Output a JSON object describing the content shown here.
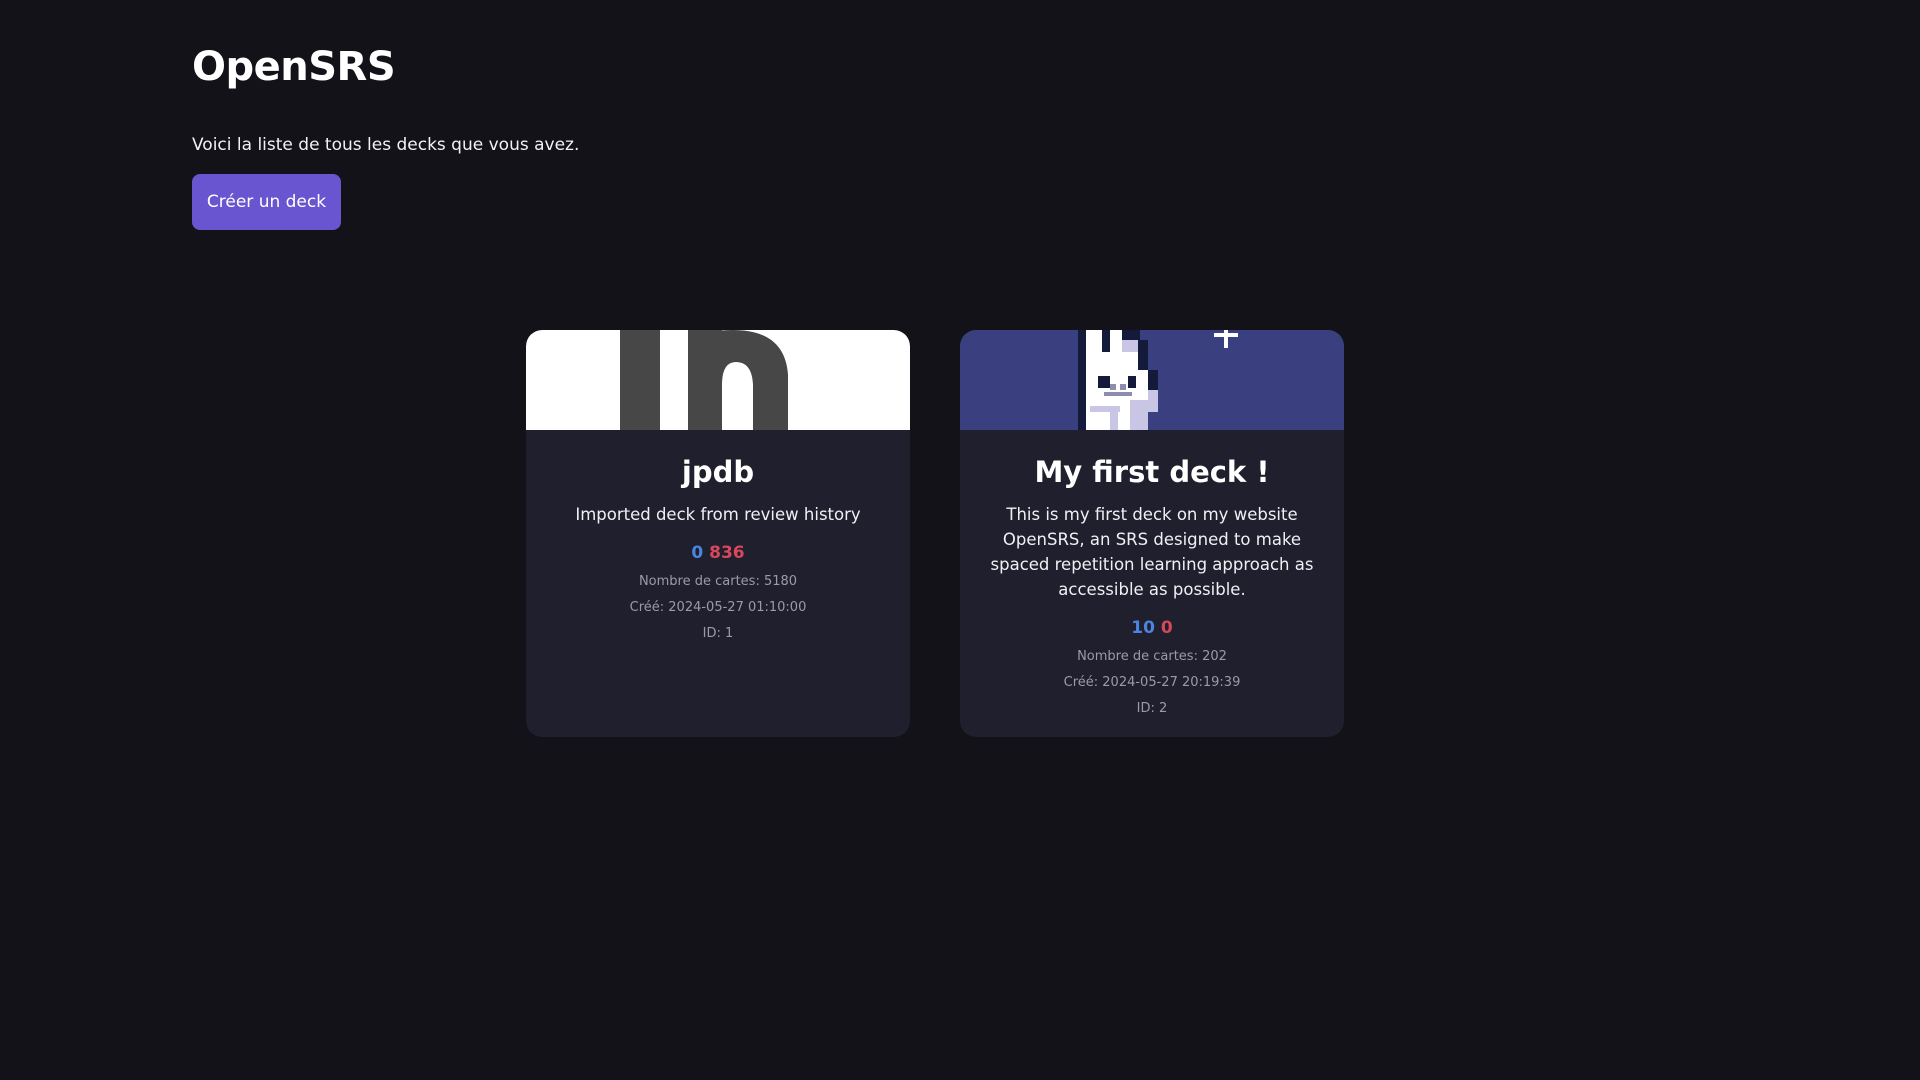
{
  "header": {
    "title": "OpenSRS",
    "intro": "Voici la liste de tous les decks que vous avez.",
    "create_button": "Créer un deck"
  },
  "decks": [
    {
      "title": "jpdb",
      "description": "Imported deck from review history",
      "new_count": "0",
      "due_count": "836",
      "cards": "Nombre de cartes: 5180",
      "created": "Créé: 2024-05-27 01:10:00",
      "id": "ID: 1",
      "banner": "jpdb-logo"
    },
    {
      "title": "My first deck !",
      "description": "This is my first deck on my website OpenSRS, an SRS designed to make spaced repetition learning approach as accessible as possible.",
      "new_count": "10",
      "due_count": "0",
      "cards": "Nombre de cartes: 202",
      "created": "Créé: 2024-05-27 20:19:39",
      "id": "ID: 2",
      "banner": "pixel-bunny"
    }
  ],
  "colors": {
    "background": "#121218",
    "card": "#1f1f2e",
    "accent": "#6a55d0",
    "new": "#4a86e0",
    "due": "#d8485a"
  }
}
